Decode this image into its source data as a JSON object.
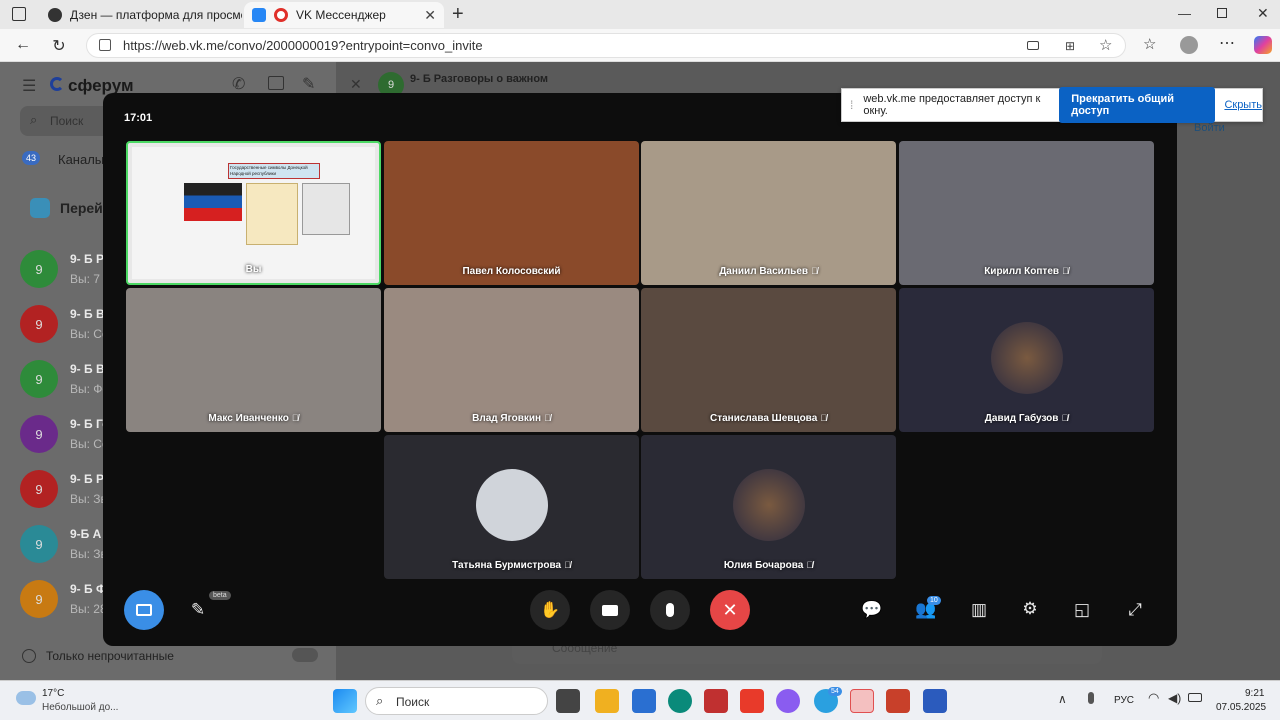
{
  "browser": {
    "tabs": [
      {
        "title": "Дзен — платформа для просмот",
        "icon": "dzen-icon"
      },
      {
        "title": "VK Мессенджер",
        "icon": "vk-call-icon"
      }
    ],
    "url": "https://web.vk.me/convo/2000000019?entrypoint=convo_invite",
    "new_tab": "+"
  },
  "sidebar": {
    "logo": "сферум",
    "search_placeholder": "Поиск",
    "channels_label": "Каналы",
    "channels_badge": "43",
    "goto_label": "Перей",
    "chats": [
      {
        "avatar": "9",
        "title": "9- Б Р",
        "snippet": "Вы: 7 м",
        "color": "#2e8b3a"
      },
      {
        "avatar": "9",
        "title": "9- Б В",
        "snippet": "Вы: Со",
        "color": "#b22222"
      },
      {
        "avatar": "9",
        "title": "9- Б В",
        "snippet": "Вы: Фо",
        "color": "#2e8b3a"
      },
      {
        "avatar": "9",
        "title": "9- Б Го",
        "snippet": "Вы: Со",
        "color": "#6a2a8a"
      },
      {
        "avatar": "9",
        "title": "9- Б Р",
        "snippet": "Вы: Зв",
        "color": "#b22222"
      },
      {
        "avatar": "9",
        "title": "9-Б А",
        "snippet": "Вы: Зв",
        "color": "#2a8a96"
      },
      {
        "avatar": "9",
        "title": "9- Б Ф",
        "snippet": "Вы: 28",
        "color": "#c87a12"
      }
    ],
    "unread_only": "Только непрочитанные"
  },
  "convo": {
    "avatar": "9",
    "title": "9- Б Разговоры о важном",
    "join_button": "Войти"
  },
  "message_placeholder": "Сообщение",
  "share_bar": {
    "text": "web.vk.me предоставляет доступ к окну.",
    "stop_button": "Прекратить общий доступ",
    "hide_link": "Скрыть"
  },
  "call": {
    "time": "17:01",
    "participants": [
      {
        "name": "Вы",
        "muted": false,
        "bg": "#e8e8e8",
        "self": true
      },
      {
        "name": "Павел Колосовский",
        "muted": false,
        "bg": "#8a4a2a"
      },
      {
        "name": "Даниил Васильев",
        "muted": true,
        "bg": "#a89a88"
      },
      {
        "name": "Кирилл Коптев",
        "muted": true,
        "bg": "#6a6a72"
      },
      {
        "name": "Макс Иванченко",
        "muted": true,
        "bg": "#8a8480"
      },
      {
        "name": "Влад Яговкин",
        "muted": true,
        "bg": "#9a8a80"
      },
      {
        "name": "Станислава Шевцова",
        "muted": true,
        "bg": "#5a4a40"
      },
      {
        "name": "Давид Габузов",
        "muted": true,
        "bg": "#2a2a3a",
        "avatar": true
      },
      {
        "name": "Татьяна Бурмистрова",
        "muted": true,
        "bg": "#2a2a30",
        "placeholder": true
      },
      {
        "name": "Юлия Бочарова",
        "muted": true,
        "bg": "#2a2a34",
        "avatar": true
      }
    ],
    "beta_badge": "beta",
    "participants_count": "10"
  },
  "slide": {
    "title": "Государственные символы Донецкой Народной республики"
  },
  "taskbar": {
    "weather_temp": "17°C",
    "weather_desc": "Небольшой до...",
    "search_placeholder": "Поиск",
    "lang": "РУС",
    "time": "9:21",
    "date": "07.05.2025",
    "telegram_badge": "54"
  }
}
